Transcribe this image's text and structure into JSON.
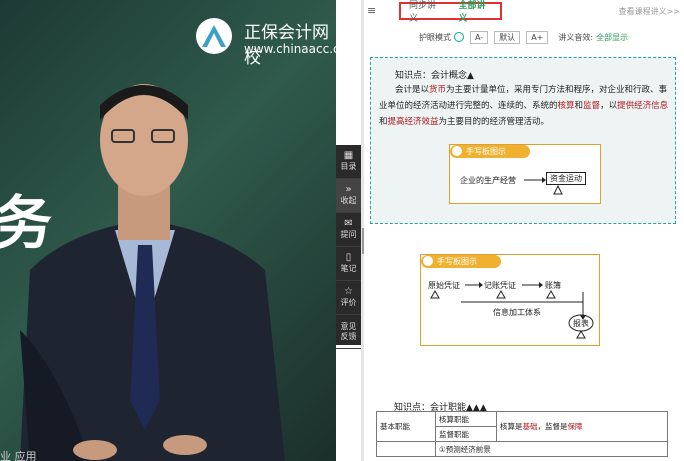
{
  "video": {
    "brand_name": "正保会计网校",
    "brand_url": "www.chinaacc.com",
    "big_char": "务",
    "bottom_text": "业 应用"
  },
  "sidebar": {
    "items": [
      {
        "icon": "grid-icon",
        "glyph": "▦",
        "label": "目录"
      },
      {
        "icon": "collapse-icon",
        "glyph": "»",
        "label": "收起"
      },
      {
        "icon": "question-icon",
        "glyph": "✉",
        "label": "提问"
      },
      {
        "icon": "note-icon",
        "glyph": "▯",
        "label": "笔记"
      },
      {
        "icon": "review-icon",
        "glyph": "☆",
        "label": "评价"
      },
      {
        "icon": "feedback-icon",
        "glyph": "",
        "label": "意见反馈"
      }
    ]
  },
  "notes": {
    "menu_glyph": "≡",
    "tabs": [
      {
        "label": "同步讲义",
        "active": false
      },
      {
        "label": "全部讲义",
        "active": true
      }
    ],
    "view_link": "查看课程讲义>>",
    "controls": {
      "eye_mode_label": "护眼模式",
      "font_smaller": "A-",
      "font_default": "默认",
      "font_larger": "A+",
      "voice_label": "讲义音效:",
      "voice_value": "全部显示"
    },
    "kp1": {
      "title": "知识点：会计概念▲",
      "body_parts": [
        {
          "text": "会计是以",
          "hl": false
        },
        {
          "text": "货币",
          "hl": true
        },
        {
          "text": "为主要计量单位，采用专门方法和程序，对企业和行政、事业单位的经济活动进行完整的、连续的、系统的",
          "hl": false
        },
        {
          "text": "核算",
          "hl": true
        },
        {
          "text": "和",
          "hl": false
        },
        {
          "text": "监督",
          "hl": true
        },
        {
          "text": "，以",
          "hl": false
        },
        {
          "text": "提供经济信息",
          "hl": true
        },
        {
          "text": "和",
          "hl": false
        },
        {
          "text": "提高经济效益",
          "hl": true
        },
        {
          "text": "为主要目的的经济管理活动。",
          "hl": false
        }
      ],
      "handwrite_title": "手写板图示",
      "diagram_left": "企业的生产经营",
      "diagram_right": "资金运动"
    },
    "hand2": {
      "title": "手写板图示",
      "n1": "原始凭证",
      "n2": "记账凭证",
      "n3": "账簿",
      "n4": "信息加工体系",
      "n5": "报表"
    },
    "kp2": {
      "title": "知识点：会计职能▲▲▲",
      "rows": [
        {
          "c1": "基本职能",
          "c2": "核算职能",
          "c3_a": "核算是",
          "c3_b": "基础",
          "c3_c": "，监督是",
          "c3_d": "保障"
        },
        {
          "c1": "",
          "c2": "监督职能",
          "c3_a": "",
          "c3_b": "",
          "c3_c": "",
          "c3_d": ""
        },
        {
          "c1": "",
          "c2": "①预测经济前景",
          "c3_a": "",
          "c3_b": "",
          "c3_c": "",
          "c3_d": ""
        }
      ]
    }
  },
  "colors": {
    "accent_green": "#2a9d5a",
    "highlight_red": "#b0141c",
    "tab_border": "#e03131",
    "handwrite_orange": "#f0b030"
  }
}
